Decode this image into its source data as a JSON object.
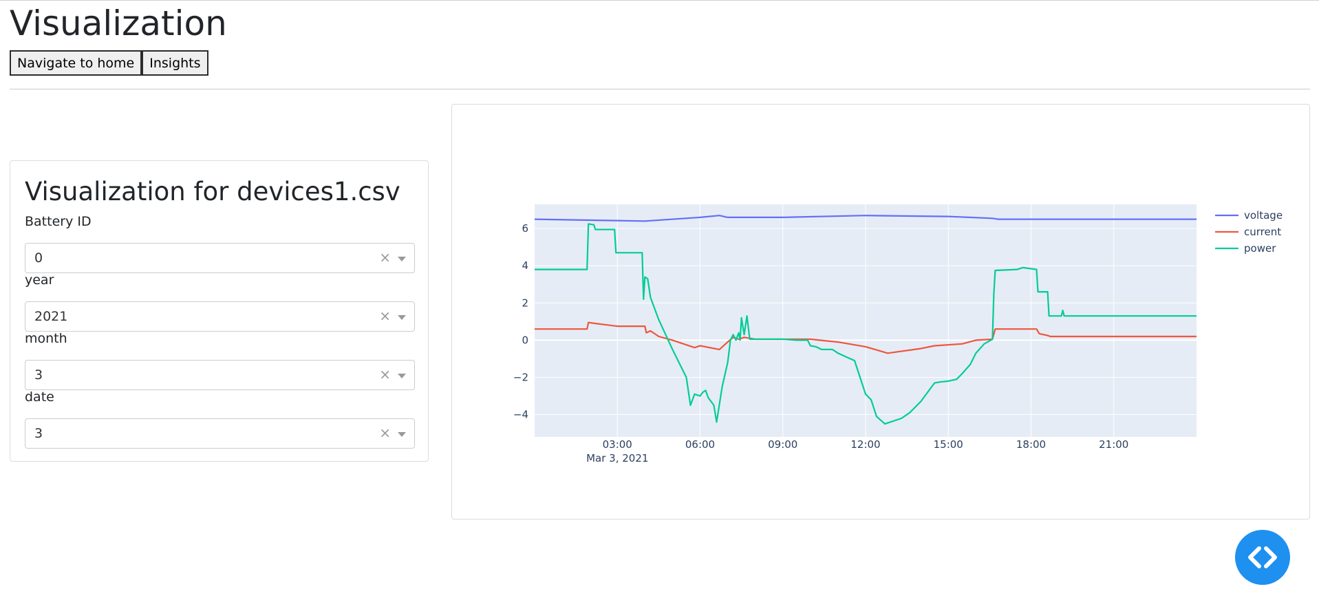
{
  "page": {
    "title": "Visualization"
  },
  "nav": {
    "home_label": "Navigate to home",
    "insights_label": "Insights"
  },
  "panel": {
    "title": "Visualization for devices1.csv",
    "fields": [
      {
        "label": "Battery ID",
        "value": "0"
      },
      {
        "label": "year",
        "value": "2021"
      },
      {
        "label": "month",
        "value": "3"
      },
      {
        "label": "date",
        "value": "3"
      }
    ],
    "clear_glyph": "×"
  },
  "chart_data": {
    "type": "line",
    "x_unit": "hours since midnight, Mar 3, 2021",
    "x_tick_labels": [
      "03:00",
      "06:00",
      "09:00",
      "12:00",
      "15:00",
      "18:00",
      "21:00"
    ],
    "x_date_label": "Mar 3, 2021",
    "y_tick_labels": [
      "6",
      "4",
      "2",
      "0",
      "−2",
      "−4"
    ],
    "xlim": [
      0,
      24
    ],
    "ylim": [
      -5.2,
      7.3
    ],
    "grid": true,
    "legend_position": "top-right",
    "series": [
      {
        "name": "voltage",
        "color": "#636efa",
        "points": [
          [
            0,
            6.5
          ],
          [
            2,
            6.45
          ],
          [
            4,
            6.4
          ],
          [
            6,
            6.6
          ],
          [
            6.7,
            6.7
          ],
          [
            7,
            6.6
          ],
          [
            9,
            6.6
          ],
          [
            12,
            6.7
          ],
          [
            15,
            6.65
          ],
          [
            16.6,
            6.55
          ],
          [
            16.8,
            6.5
          ],
          [
            24,
            6.5
          ]
        ]
      },
      {
        "name": "current",
        "color": "#ef553b",
        "points": [
          [
            0,
            0.6
          ],
          [
            1.9,
            0.6
          ],
          [
            1.95,
            0.95
          ],
          [
            2.2,
            0.9
          ],
          [
            3,
            0.75
          ],
          [
            4,
            0.75
          ],
          [
            4.05,
            0.4
          ],
          [
            4.2,
            0.5
          ],
          [
            4.5,
            0.2
          ],
          [
            5,
            0
          ],
          [
            5.8,
            -0.4
          ],
          [
            6,
            -0.3
          ],
          [
            6.7,
            -0.5
          ],
          [
            7,
            -0.1
          ],
          [
            7.2,
            0.15
          ],
          [
            7.4,
            0.05
          ],
          [
            7.6,
            0.15
          ],
          [
            8,
            0.05
          ],
          [
            10,
            0.05
          ],
          [
            11,
            -0.1
          ],
          [
            12,
            -0.35
          ],
          [
            12.8,
            -0.7
          ],
          [
            14,
            -0.45
          ],
          [
            14.5,
            -0.3
          ],
          [
            15.5,
            -0.2
          ],
          [
            16,
            0
          ],
          [
            16.6,
            0.05
          ],
          [
            16.7,
            0.6
          ],
          [
            18.2,
            0.6
          ],
          [
            18.3,
            0.35
          ],
          [
            18.6,
            0.25
          ],
          [
            18.7,
            0.2
          ],
          [
            24,
            0.2
          ]
        ]
      },
      {
        "name": "power",
        "color": "#00cc96",
        "points": [
          [
            0,
            3.8
          ],
          [
            1.9,
            3.8
          ],
          [
            1.95,
            6.25
          ],
          [
            2.15,
            6.2
          ],
          [
            2.2,
            5.95
          ],
          [
            2.9,
            5.95
          ],
          [
            2.95,
            4.7
          ],
          [
            3.9,
            4.7
          ],
          [
            3.95,
            2.2
          ],
          [
            4,
            3.4
          ],
          [
            4.1,
            3.3
          ],
          [
            4.2,
            2.3
          ],
          [
            4.5,
            1.1
          ],
          [
            5,
            -0.5
          ],
          [
            5.5,
            -2
          ],
          [
            5.6,
            -3
          ],
          [
            5.65,
            -3.5
          ],
          [
            5.8,
            -2.9
          ],
          [
            6,
            -3
          ],
          [
            6.1,
            -2.8
          ],
          [
            6.2,
            -2.7
          ],
          [
            6.3,
            -3.1
          ],
          [
            6.5,
            -3.5
          ],
          [
            6.6,
            -4.4
          ],
          [
            6.8,
            -2.5
          ],
          [
            7,
            -1.2
          ],
          [
            7.1,
            0
          ],
          [
            7.2,
            0.3
          ],
          [
            7.3,
            0
          ],
          [
            7.4,
            0.4
          ],
          [
            7.45,
            0
          ],
          [
            7.5,
            1.2
          ],
          [
            7.6,
            0.3
          ],
          [
            7.7,
            1.3
          ],
          [
            7.8,
            0.05
          ],
          [
            9,
            0.05
          ],
          [
            9.5,
            0
          ],
          [
            9.9,
            0
          ],
          [
            10,
            -0.3
          ],
          [
            10.2,
            -0.35
          ],
          [
            10.4,
            -0.5
          ],
          [
            10.8,
            -0.5
          ],
          [
            11,
            -0.7
          ],
          [
            11.3,
            -0.9
          ],
          [
            11.6,
            -1.1
          ],
          [
            11.8,
            -2
          ],
          [
            12,
            -2.9
          ],
          [
            12.2,
            -3.2
          ],
          [
            12.4,
            -4.1
          ],
          [
            12.7,
            -4.5
          ],
          [
            13.3,
            -4.2
          ],
          [
            13.6,
            -3.9
          ],
          [
            14,
            -3.3
          ],
          [
            14.3,
            -2.7
          ],
          [
            14.5,
            -2.3
          ],
          [
            14.7,
            -2.25
          ],
          [
            15,
            -2.2
          ],
          [
            15.3,
            -2.1
          ],
          [
            15.5,
            -1.8
          ],
          [
            15.8,
            -1.3
          ],
          [
            16,
            -0.7
          ],
          [
            16.3,
            -0.2
          ],
          [
            16.6,
            0.05
          ],
          [
            16.65,
            2.5
          ],
          [
            16.7,
            3.75
          ],
          [
            17.5,
            3.8
          ],
          [
            17.7,
            3.9
          ],
          [
            18.2,
            3.8
          ],
          [
            18.25,
            2.6
          ],
          [
            18.6,
            2.6
          ],
          [
            18.65,
            1.3
          ],
          [
            19.1,
            1.3
          ],
          [
            19.15,
            1.6
          ],
          [
            19.2,
            1.3
          ],
          [
            24,
            1.3
          ]
        ]
      }
    ]
  }
}
